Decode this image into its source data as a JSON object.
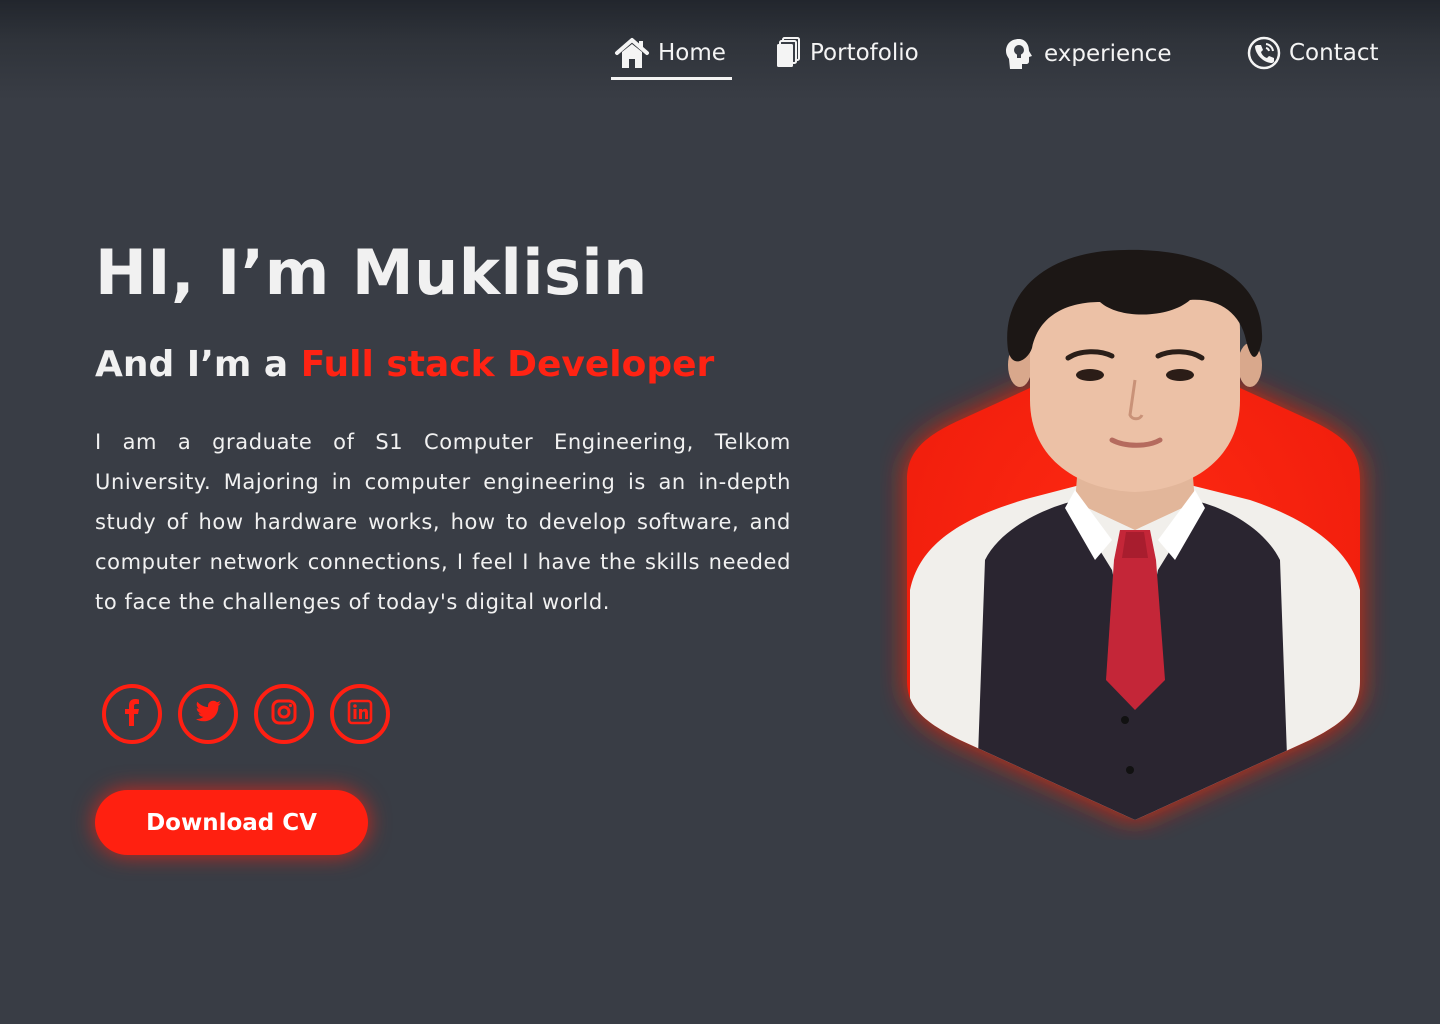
{
  "nav": {
    "items": [
      {
        "label": "Home",
        "icon": "home-icon",
        "active": true
      },
      {
        "label": "Portofolio",
        "icon": "documents-icon",
        "active": false
      },
      {
        "label": "experience",
        "icon": "head-lightbulb-icon",
        "active": false
      },
      {
        "label": "Contact",
        "icon": "phone-icon",
        "active": false
      }
    ]
  },
  "hero": {
    "title": "HI, I’m Muklisin",
    "subtitle_prefix": "And I’m a ",
    "subtitle_role": "Full stack Developer",
    "bio": "I am a graduate of S1 Computer Engineering, Telkom University. Majoring in computer engineering is an in-depth study of how hardware works, how to develop software, and computer network connections, I feel I have the skills needed to face the challenges of today's digital world.",
    "cv_button": "Download CV"
  },
  "socials": [
    {
      "icon": "facebook-icon"
    },
    {
      "icon": "twitter-icon"
    },
    {
      "icon": "instagram-icon"
    },
    {
      "icon": "linkedin-icon"
    }
  ],
  "colors": {
    "background": "#393d45",
    "accent": "#ff2313",
    "text": "#f1f1f1"
  }
}
